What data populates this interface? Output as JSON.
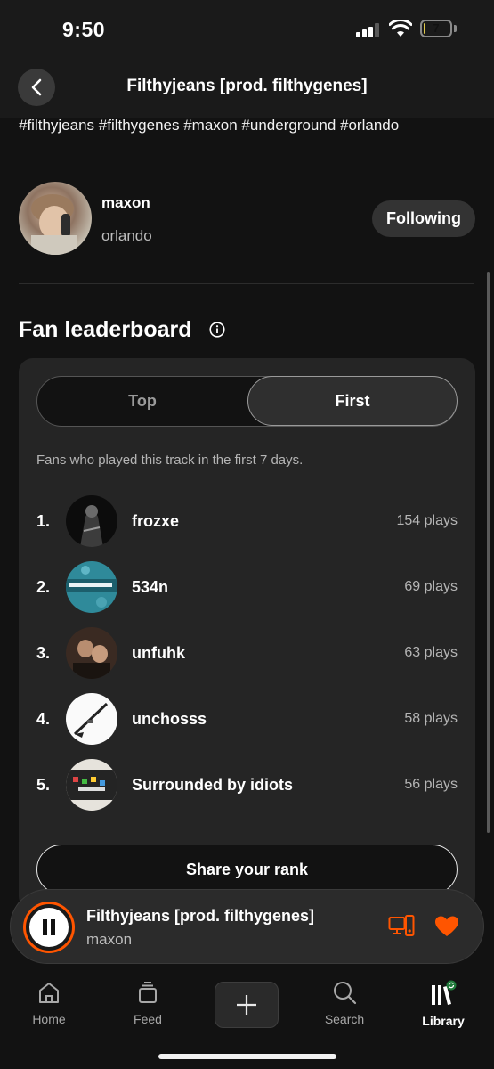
{
  "status": {
    "time": "9:50",
    "battery": "7",
    "battery_level": 0.07
  },
  "header": {
    "title": "Filthyjeans [prod. filthygenes]",
    "back_icon": "chevron-left-icon"
  },
  "track": {
    "tags": "#filthyjeans #filthygenes #maxon #underground #orlando"
  },
  "artist": {
    "name": "maxon",
    "city": "orlando",
    "follow_label": "Following"
  },
  "leaderboard": {
    "title": "Fan leaderboard",
    "tabs": {
      "top": "Top",
      "first": "First"
    },
    "selected_tab": "First",
    "description": "Fans who played this track in the first 7 days.",
    "fans": [
      {
        "rank": "1.",
        "name": "frozxe",
        "plays": "154 plays"
      },
      {
        "rank": "2.",
        "name": "534n",
        "plays": "69 plays"
      },
      {
        "rank": "3.",
        "name": "unfuhk",
        "plays": "63 plays"
      },
      {
        "rank": "4.",
        "name": "unchosss",
        "plays": "58 plays"
      },
      {
        "rank": "5.",
        "name": "Surrounded by idiots",
        "plays": "56 plays"
      }
    ],
    "share_label": "Share your rank"
  },
  "player": {
    "title": "Filthyjeans [prod. filthygenes]",
    "artist": "maxon",
    "accent_color": "#ff5500"
  },
  "tabbar": {
    "items": [
      {
        "label": "Home",
        "icon": "home-icon"
      },
      {
        "label": "Feed",
        "icon": "feed-icon"
      },
      {
        "label": "Search",
        "icon": "search-icon"
      },
      {
        "label": "Library",
        "icon": "library-icon"
      }
    ],
    "active": "Library"
  }
}
